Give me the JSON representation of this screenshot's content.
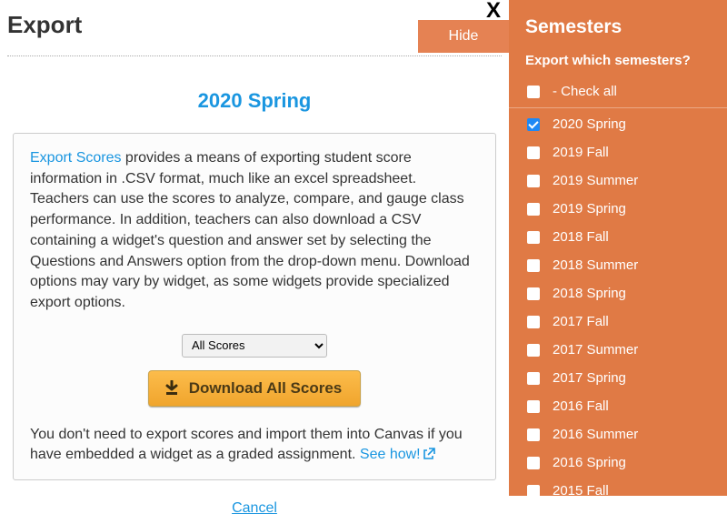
{
  "header": {
    "title": "Export",
    "close_label": "X",
    "hide_label": "Hide"
  },
  "current_semester": "2020 Spring",
  "description": {
    "link_text": "Export Scores",
    "body_text": " provides a means of exporting student score information in .CSV format, much like an excel spreadsheet. Teachers can use the scores to analyze, compare, and gauge class performance. In addition, teachers can also download a CSV containing a widget's question and answer set by selecting the Questions and Answers option from the drop-down menu. Download options may vary by widget, as some widgets provide specialized export options."
  },
  "select": {
    "selected": "All Scores"
  },
  "download_button": "Download All Scores",
  "footnote": {
    "text": "You don't need to export scores and import them into Canvas if you have embedded a widget as a graded assignment. ",
    "link": "See how!"
  },
  "cancel": "Cancel",
  "sidebar": {
    "title": "Semesters",
    "subhead": "Export which semesters?",
    "check_all_label": "- Check all",
    "items": [
      {
        "label": "2020 Spring",
        "checked": true
      },
      {
        "label": "2019 Fall",
        "checked": false
      },
      {
        "label": "2019 Summer",
        "checked": false
      },
      {
        "label": "2019 Spring",
        "checked": false
      },
      {
        "label": "2018 Fall",
        "checked": false
      },
      {
        "label": "2018 Summer",
        "checked": false
      },
      {
        "label": "2018 Spring",
        "checked": false
      },
      {
        "label": "2017 Fall",
        "checked": false
      },
      {
        "label": "2017 Summer",
        "checked": false
      },
      {
        "label": "2017 Spring",
        "checked": false
      },
      {
        "label": "2016 Fall",
        "checked": false
      },
      {
        "label": "2016 Summer",
        "checked": false
      },
      {
        "label": "2016 Spring",
        "checked": false
      },
      {
        "label": "2015 Fall",
        "checked": false
      }
    ]
  }
}
